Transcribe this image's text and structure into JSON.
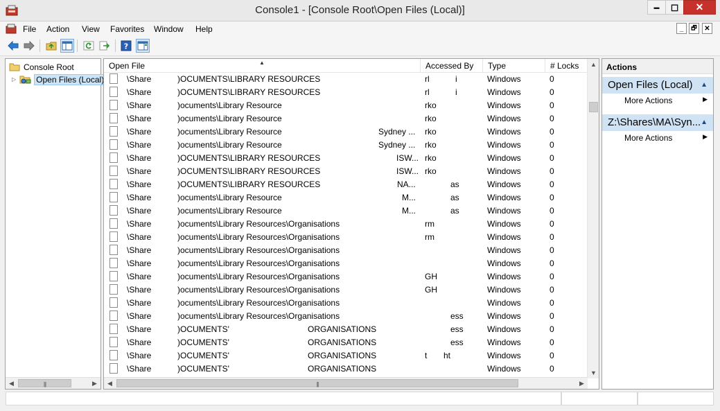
{
  "window": {
    "title": "Console1 - [Console Root\\Open Files (Local)]",
    "minimize_glyph": "▬",
    "maximize_glyph": "◻",
    "close_glyph": "✕"
  },
  "menu": {
    "items": [
      "File",
      "Action",
      "View",
      "Favorites",
      "Window",
      "Help"
    ],
    "mdi_min": "_",
    "mdi_restore": "🗗",
    "mdi_close": "✕"
  },
  "toolbar": {
    "icons": [
      "back-icon",
      "forward-icon",
      "up-folder-icon",
      "show-hide-tree-icon",
      "refresh-icon",
      "export-list-icon",
      "help-icon",
      "show-hide-action-pane-icon"
    ]
  },
  "tree": {
    "root": "Console Root",
    "child": "Open Files (Local)",
    "expander": "▷"
  },
  "list": {
    "columns": [
      "Open File",
      "Accessed By",
      "Type",
      "# Locks"
    ],
    "sort_glyph": "▲",
    "rows": [
      {
        "share": "\\Share",
        "path": ")OCUMENTS\\LIBRARY RESOURCES",
        "mid": "",
        "user": "rl",
        "user2": "i",
        "type": "Windows",
        "locks": "0"
      },
      {
        "share": "\\Share",
        "path": ")OCUMENTS\\LIBRARY RESOURCES",
        "mid": "",
        "user": "rl",
        "user2": "i",
        "type": "Windows",
        "locks": "0"
      },
      {
        "share": "\\Share",
        "path": ")ocuments\\Library Resource",
        "mid": "",
        "user": "rko",
        "user2": "",
        "type": "Windows",
        "locks": "0"
      },
      {
        "share": "\\Share",
        "path": ")ocuments\\Library Resource",
        "mid": "",
        "user": "rko",
        "user2": "",
        "type": "Windows",
        "locks": "0"
      },
      {
        "share": "\\Share",
        "path": ")ocuments\\Library Resource",
        "mid": "Sydney ...",
        "user": "rko",
        "user2": "",
        "type": "Windows",
        "locks": "0"
      },
      {
        "share": "\\Share",
        "path": ")ocuments\\Library Resource",
        "mid": "Sydney ...",
        "user": "rko",
        "user2": "",
        "type": "Windows",
        "locks": "0"
      },
      {
        "share": "\\Share",
        "path": ")OCUMENTS\\LIBRARY RESOURCES",
        "mid": "ISW...",
        "user": "rko",
        "user2": "",
        "type": "Windows",
        "locks": "0"
      },
      {
        "share": "\\Share",
        "path": ")OCUMENTS\\LIBRARY RESOURCES",
        "mid": "ISW...",
        "user": "rko",
        "user2": "",
        "type": "Windows",
        "locks": "0"
      },
      {
        "share": "\\Share",
        "path": ")OCUMENTS\\LIBRARY RESOURCES",
        "mid": "NA...",
        "user": "",
        "user2": "as",
        "type": "Windows",
        "locks": "0"
      },
      {
        "share": "\\Share",
        "path": ")ocuments\\Library Resource",
        "mid": "M...",
        "user": "",
        "user2": "as",
        "type": "Windows",
        "locks": "0"
      },
      {
        "share": "\\Share",
        "path": ")ocuments\\Library Resource",
        "mid": "M...",
        "user": "",
        "user2": "as",
        "type": "Windows",
        "locks": "0"
      },
      {
        "share": "\\Share",
        "path": ")ocuments\\Library Resources\\Organisations",
        "mid": "",
        "user": "rm",
        "user2": "",
        "type": "Windows",
        "locks": "0"
      },
      {
        "share": "\\Share",
        "path": ")ocuments\\Library Resources\\Organisations",
        "mid": "",
        "user": "rm",
        "user2": "",
        "type": "Windows",
        "locks": "0"
      },
      {
        "share": "\\Share",
        "path": ")ocuments\\Library Resources\\Organisations",
        "mid": "",
        "user": "",
        "user2": "",
        "type": "Windows",
        "locks": "0"
      },
      {
        "share": "\\Share",
        "path": ")ocuments\\Library Resources\\Organisations",
        "mid": "",
        "user": "",
        "user2": "",
        "type": "Windows",
        "locks": "0"
      },
      {
        "share": "\\Share",
        "path": ")ocuments\\Library Resources\\Organisations",
        "mid": "",
        "user": "GH",
        "user2": "",
        "type": "Windows",
        "locks": "0"
      },
      {
        "share": "\\Share",
        "path": ")ocuments\\Library Resources\\Organisations",
        "mid": "",
        "user": "GH",
        "user2": "",
        "type": "Windows",
        "locks": "0"
      },
      {
        "share": "\\Share",
        "path": ")ocuments\\Library Resources\\Organisations",
        "mid": "",
        "user": "",
        "user2": "",
        "type": "Windows",
        "locks": "0"
      },
      {
        "share": "\\Share",
        "path": ")ocuments\\Library Resources\\Organisations",
        "mid": "",
        "user": "",
        "user2": "ess",
        "type": "Windows",
        "locks": "0"
      },
      {
        "share": "\\Share",
        "path": ")OCUMENTS'",
        "mid": "ORGANISATIONS",
        "user": "",
        "user2": "ess",
        "type": "Windows",
        "locks": "0"
      },
      {
        "share": "\\Share",
        "path": ")OCUMENTS'",
        "mid": "ORGANISATIONS",
        "user": "",
        "user2": "ess",
        "type": "Windows",
        "locks": "0"
      },
      {
        "share": "\\Share",
        "path": ")OCUMENTS'",
        "mid": "ORGANISATIONS",
        "user": "t",
        "user2": "ht",
        "type": "Windows",
        "locks": "0"
      },
      {
        "share": "\\Share",
        "path": ")OCUMENTS'",
        "mid": "ORGANISATIONS",
        "user": "",
        "user2": "",
        "type": "Windows",
        "locks": "0"
      }
    ]
  },
  "actions": {
    "title": "Actions",
    "sections": [
      {
        "label": "Open Files (Local)",
        "item": "More Actions"
      },
      {
        "label": "Z:\\Shares\\MA\\Syn...",
        "item": "More Actions"
      }
    ]
  },
  "colors": {
    "accent": "#cfe3f4",
    "close": "#c7312b"
  }
}
